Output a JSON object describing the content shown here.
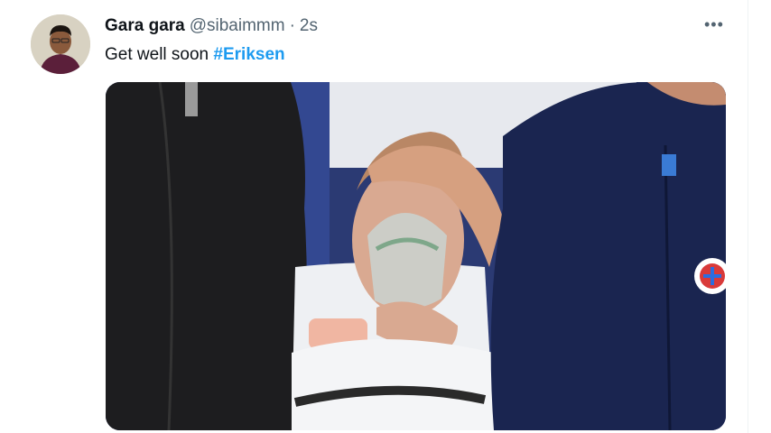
{
  "tweet": {
    "display_name": "Gara gara",
    "handle": "@sibaimmm",
    "separator": "·",
    "time": "2s",
    "text": "Get well soon",
    "hashtag": "#Eriksen",
    "more_icon": "more-horizontal-icon"
  },
  "colors": {
    "link": "#1d9bf0",
    "text": "#0f1419",
    "secondary": "#536471"
  }
}
